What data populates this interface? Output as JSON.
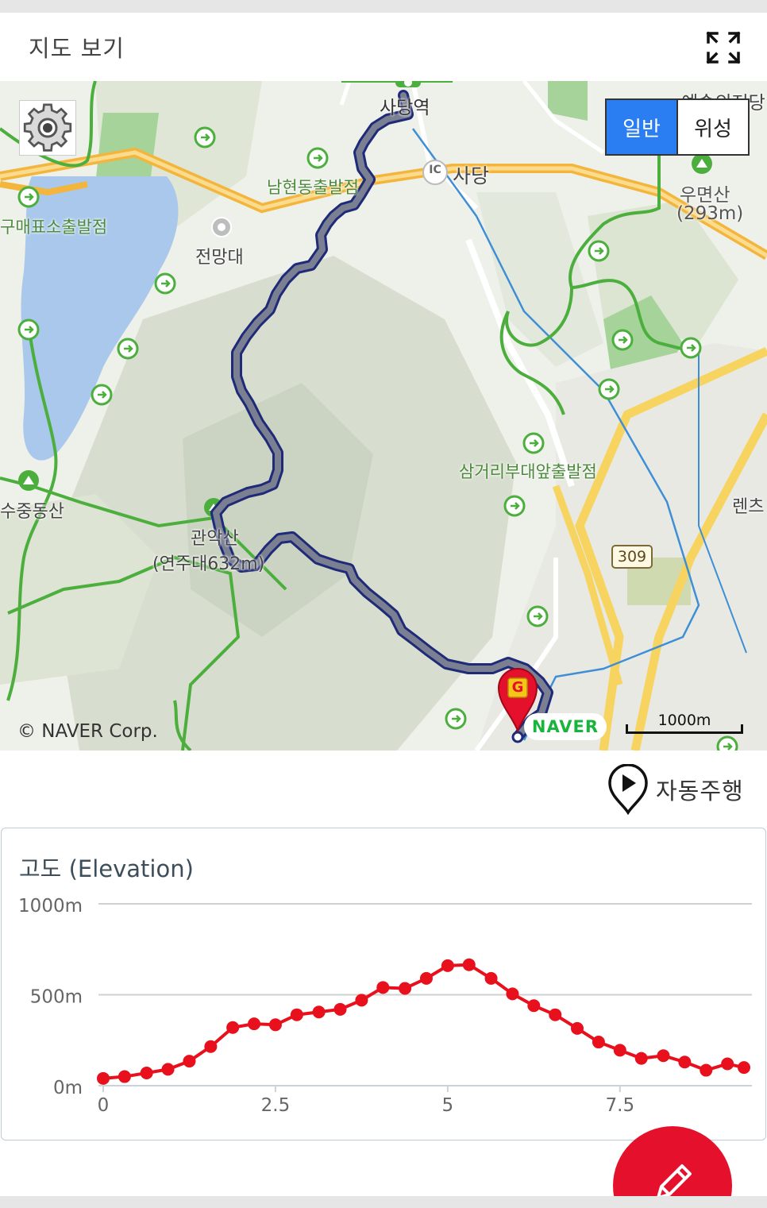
{
  "header": {
    "title": "지도 보기",
    "fullscreen_icon": "expand-arrows-icon"
  },
  "map": {
    "settings_icon": "gear-icon",
    "type_toggle": {
      "normal": "일반",
      "satellite": "위성",
      "selected": "normal"
    },
    "labels": {
      "sadang_station": "사당역",
      "sadang_ic": "사당",
      "ic_badge": "IC",
      "namhyeon": "남현동출발점",
      "umyeonsan": "우면산",
      "umyeonsan_height": "(293m)",
      "jeonmangdae": "전망대",
      "maepyo": "구매표소출발점",
      "samgeori": "삼거리부대앞출발점",
      "sujung": "수중동산",
      "gwanaksan": "관악산",
      "yeonjudae": "(연주대632m)",
      "road_309": "309",
      "renz": "렌츠",
      "art_hall": "예술의전당"
    },
    "goal_marker": "G",
    "copyright": "© NAVER Corp.",
    "naver_logo": "NAVER",
    "scale_label": "1000m",
    "colors": {
      "route": "#7a7f92",
      "route_edge": "#1f2a78",
      "trail": "#4caf3d",
      "highway": "#f3b53c",
      "road": "#f6d45f",
      "water": "#a9c8ec",
      "marker": "#e5102b"
    }
  },
  "autoplay": {
    "label": "자동주행",
    "icon": "play-pin-icon"
  },
  "elevation": {
    "title": "고도 (Elevation)",
    "fab_icon": "pencil-icon"
  },
  "chart_data": {
    "type": "line",
    "title": "고도 (Elevation)",
    "xlabel": "",
    "ylabel": "",
    "xlim": [
      0,
      9.3
    ],
    "ylim": [
      0,
      1000
    ],
    "xticks": [
      "0",
      "2.5",
      "5",
      "7.5"
    ],
    "yticks": [
      "0m",
      "500m",
      "1000m"
    ],
    "grid": true,
    "series": [
      {
        "color": "#e8101c",
        "x": [
          0,
          0.31,
          0.63,
          0.94,
          1.25,
          1.56,
          1.88,
          2.19,
          2.5,
          2.81,
          3.13,
          3.44,
          3.75,
          4.06,
          4.38,
          4.69,
          5.0,
          5.31,
          5.63,
          5.94,
          6.25,
          6.56,
          6.88,
          7.19,
          7.5,
          7.81,
          8.13,
          8.44,
          8.75,
          9.06,
          9.3
        ],
        "y": [
          40,
          50,
          70,
          90,
          135,
          215,
          320,
          340,
          335,
          390,
          405,
          420,
          470,
          540,
          535,
          590,
          660,
          665,
          590,
          505,
          440,
          390,
          315,
          240,
          195,
          150,
          165,
          130,
          85,
          120,
          100
        ]
      }
    ]
  }
}
